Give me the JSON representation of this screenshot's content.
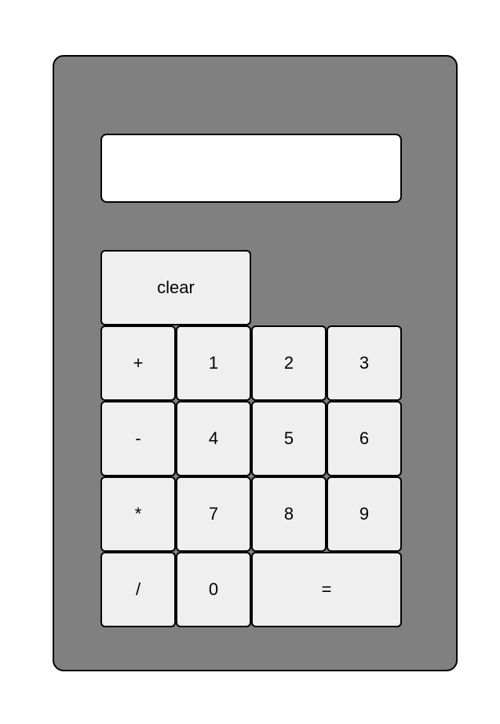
{
  "calculator": {
    "display_value": "",
    "colors": {
      "body": "#808080",
      "display": "#ffffff",
      "key": "#efefef",
      "border": "#000000"
    },
    "keys": {
      "clear": "clear",
      "plus": "+",
      "one": "1",
      "two": "2",
      "three": "3",
      "minus": "-",
      "four": "4",
      "five": "5",
      "six": "6",
      "multiply": "*",
      "seven": "7",
      "eight": "8",
      "nine": "9",
      "divide": "/",
      "zero": "0",
      "equals": "="
    }
  }
}
